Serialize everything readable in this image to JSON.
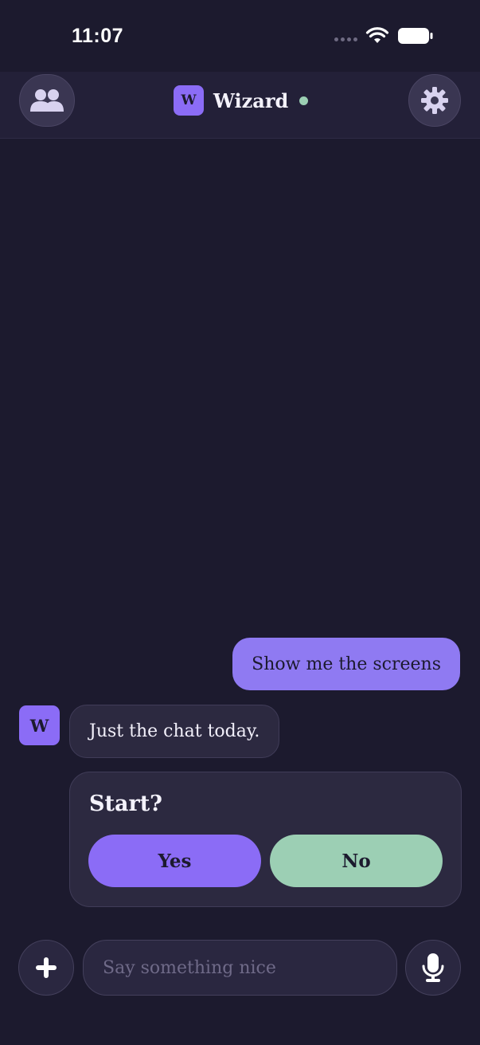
{
  "status_bar": {
    "time": "11:07"
  },
  "header": {
    "avatar_letter": "W",
    "title": "Wizard",
    "online_color": "#9ccfb4"
  },
  "messages": {
    "user_message": "Show me the screens",
    "bot_avatar_letter": "W",
    "bot_message": "Just the chat today."
  },
  "prompt_card": {
    "title": "Start?",
    "yes_label": "Yes",
    "no_label": "No"
  },
  "composer": {
    "placeholder": "Say something nice"
  },
  "icons": [
    "people-icon",
    "gear-icon",
    "plus-icon",
    "microphone-icon",
    "wifi-icon",
    "battery-icon"
  ],
  "colors": {
    "background": "#1c1a2e",
    "accent_purple": "#8b6cf6",
    "accent_green": "#9ccfb4",
    "user_bubble": "#8f7af2"
  }
}
